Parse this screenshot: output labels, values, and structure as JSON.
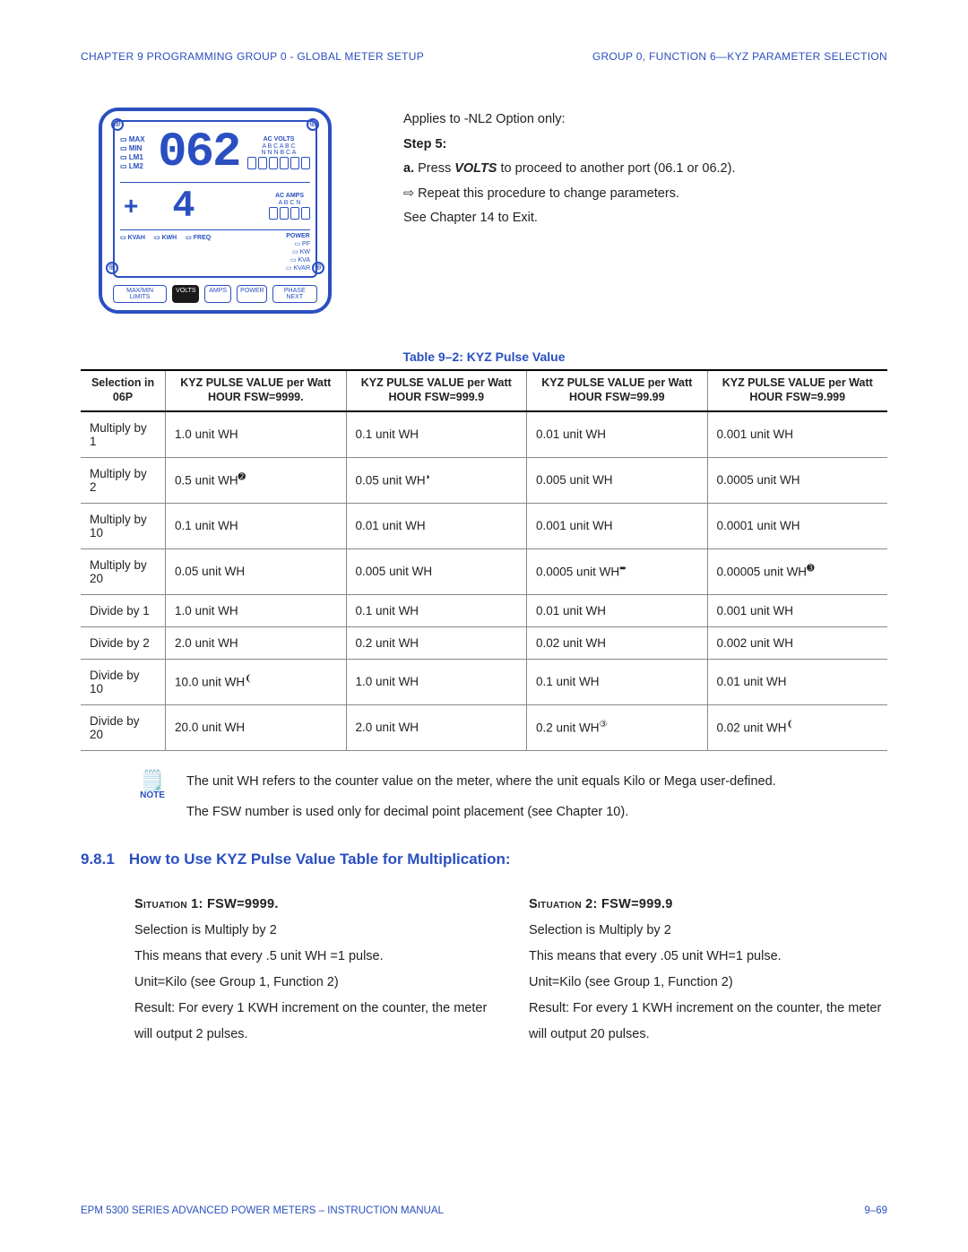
{
  "header": {
    "left": "CHAPTER 9  PROGRAMMING GROUP 0 - GLOBAL METER SETUP",
    "right": "GROUP 0, FUNCTION 6—KYZ PARAMETER SELECTION"
  },
  "meter": {
    "side_labels": [
      "MAX",
      "MIN",
      "LM1",
      "LM2"
    ],
    "big": "062",
    "ac_volts_title": "AC VOLTS",
    "ac_volts_sub1": "A  B  C  A  B  C",
    "ac_volts_sub2": "N  N  N  B  C  A",
    "ac_amps_title": "AC AMPS",
    "ac_amps_sub": "A  B  C  N",
    "four": "4",
    "power_title": "POWER",
    "power_items": [
      "PF",
      "KW",
      "KVA",
      "KVAR"
    ],
    "bottom": [
      "KVAH",
      "KWH",
      "FREQ"
    ],
    "buttons": [
      "MAX/MIN LIMITS",
      "VOLTS",
      "AMPS",
      "POWER",
      "PHASE NEXT"
    ]
  },
  "instructions": {
    "applies": "Applies to -NL2 Option only:",
    "step_label": "Step 5:",
    "a_prefix": "a. ",
    "a_press": "Press ",
    "a_bold": "VOLTS",
    "a_rest": " to proceed to another port (06.1 or   06.2).",
    "repeat": " Repeat this procedure to change parameters.",
    "see": "See Chapter 14 to Exit."
  },
  "table": {
    "caption": "Table 9–2: KYZ Pulse Value",
    "headers": [
      "Selection in 06P",
      "KYZ PULSE VALUE per Watt HOUR FSW=9999.",
      "KYZ PULSE VALUE per Watt HOUR FSW=999.9",
      "KYZ PULSE VALUE per Watt HOUR FSW=99.99",
      "KYZ PULSE VALUE per Watt HOUR FSW=9.999"
    ],
    "rows": [
      {
        "sel": "Multiply by 1",
        "c1": "1.0 unit WH",
        "c2": "0.1 unit WH",
        "c3": "0.01 unit WH",
        "c4": "0.001 unit WH"
      },
      {
        "sel": "Multiply by 2",
        "c1": "0.5 unit WH",
        "c1s": "➋",
        "c2": "0.05 unit WH",
        "c2s": "◗",
        "c3": "0.005 unit WH",
        "c4": "0.0005 unit WH"
      },
      {
        "sel": "Multiply by 10",
        "c1": "0.1 unit WH",
        "c2": "0.01 unit WH",
        "c3": "0.001 unit WH",
        "c4": "0.0001 unit WH"
      },
      {
        "sel": "Multiply by 20",
        "c1": "0.05 unit WH",
        "c2": "0.005 unit WH",
        "c3": "0.0005 unit WH",
        "c3s": "➨",
        "c4": "0.00005 unit WH",
        "c4s": "➌"
      },
      {
        "sel": "Divide by 1",
        "c1": "1.0 unit WH",
        "c2": "0.1 unit WH",
        "c3": "0.01 unit WH",
        "c4": "0.001 unit WH"
      },
      {
        "sel": "Divide by 2",
        "c1": "2.0 unit WH",
        "c2": "0.2 unit WH",
        "c3": "0.02 unit WH",
        "c4": "0.002 unit WH"
      },
      {
        "sel": "Divide by 10",
        "c1": "10.0 unit WH",
        "c1s": "❨",
        "c2": "1.0 unit WH",
        "c3": "0.1 unit WH",
        "c4": "0.01 unit WH"
      },
      {
        "sel": "Divide by 20",
        "c1": "20.0 unit WH",
        "c2": "2.0 unit WH",
        "c3": "0.2 unit WH",
        "c3s": "③",
        "c4": "0.02 unit WH",
        "c4s": "❨"
      }
    ]
  },
  "note": {
    "label": "NOTE",
    "p1": "The unit WH refers to the counter value on the meter, where the unit equals Kilo or Mega user-defined.",
    "p2": "The FSW number is used only for decimal point placement (see Chapter 10)."
  },
  "section": {
    "num": "9.8.1",
    "title": "How to Use KYZ Pulse Value Table for Multiplication:"
  },
  "situations": {
    "s1": {
      "head": "Situation 1:  FSW=9999.",
      "l1": "Selection is Multiply by 2",
      "l2": "This means that every .5 unit WH =1 pulse.",
      "l3": "Unit=Kilo (see Group 1, Function 2)",
      "l4": "Result: For every 1 KWH increment on the counter, the meter will output 2 pulses."
    },
    "s2": {
      "head": "Situation 2:  FSW=999.9",
      "l1": "Selection is Multiply by 2",
      "l2": "This means that every .05 unit WH=1 pulse.",
      "l3": "Unit=Kilo (see Group 1, Function 2)",
      "l4": "Result: For every 1 KWH increment on the counter, the meter will output 20 pulses."
    }
  },
  "footer": {
    "left": "EPM 5300 SERIES ADVANCED POWER METERS – INSTRUCTION MANUAL",
    "right": "9–69"
  }
}
